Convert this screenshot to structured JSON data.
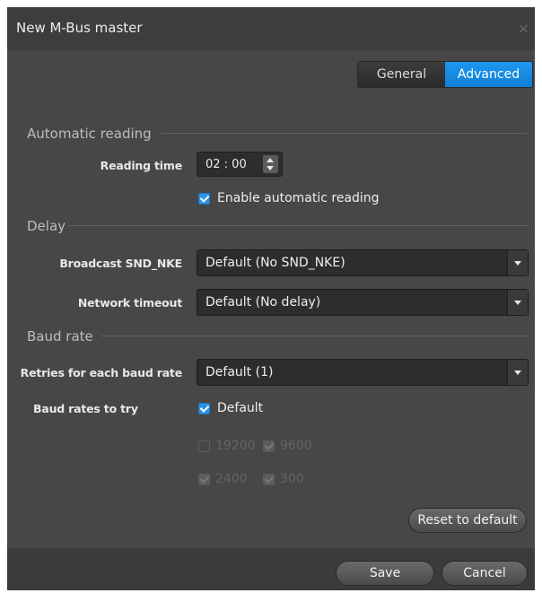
{
  "window": {
    "title": "New M-Bus master",
    "close_glyph": "×"
  },
  "tabs": [
    {
      "label": "General",
      "active": false
    },
    {
      "label": "Advanced",
      "active": true
    }
  ],
  "automatic_reading": {
    "section_title": "Automatic reading",
    "reading_time_label": "Reading time",
    "reading_time_value": "02 : 00",
    "enable_label": "Enable automatic reading",
    "enable_checked": true
  },
  "delay": {
    "section_title": "Delay",
    "broadcast_label": "Broadcast SND_NKE",
    "broadcast_value": "Default (No SND_NKE)",
    "timeout_label": "Network timeout",
    "timeout_value": "Default (No delay)"
  },
  "baud_rate": {
    "section_title": "Baud rate",
    "retries_label": "Retries for each baud rate",
    "retries_value": "Default (1)",
    "try_label": "Baud rates to try",
    "default_label": "Default",
    "default_checked": true,
    "rates": [
      {
        "label": "19200",
        "checked": false
      },
      {
        "label": "9600",
        "checked": true
      },
      {
        "label": "2400",
        "checked": true
      },
      {
        "label": "300",
        "checked": true
      }
    ]
  },
  "buttons": {
    "reset": "Reset to default",
    "save": "Save",
    "cancel": "Cancel"
  },
  "colors": {
    "accent": "#1e98ee",
    "dialog_bg": "#474747",
    "titlebar_bg": "#3d3d3d"
  }
}
